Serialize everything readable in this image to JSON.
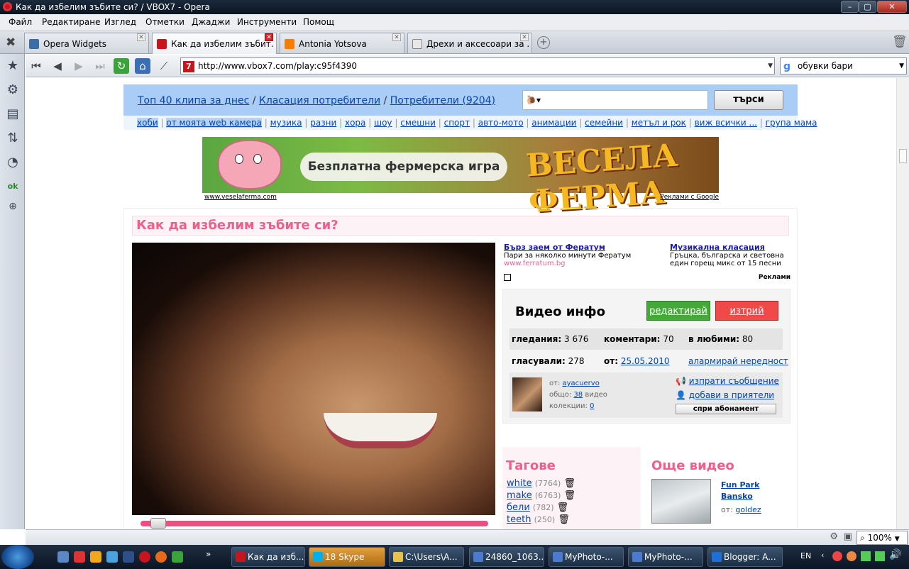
{
  "window": {
    "title": "Как да избелим зъбите си? / VBOX7 - Opera",
    "min": "–",
    "max": "▢",
    "close": "✕"
  },
  "menu": [
    "Файл",
    "Редактиране",
    "Изглед",
    "Отметки",
    "Джаджи",
    "Инструменти",
    "Помощ"
  ],
  "tabs": [
    {
      "label": "Opera Widgets",
      "icon_color": "#3a6ea5"
    },
    {
      "label": "Как да избелим зъбит...",
      "icon_color": "#c8141b"
    },
    {
      "label": "Antonia Yotsova",
      "icon_color": "#f57d00"
    },
    {
      "label": "Дрехи и аксесоари за ...",
      "icon_color": "#888888"
    }
  ],
  "nav": {
    "url": "http://www.vbox7.com/play:c95f4390",
    "url_icon": "7",
    "search_value": "обувки бари",
    "search_icon": "g"
  },
  "site": {
    "crumbs": [
      {
        "text": "Топ 40 клипа за днес"
      },
      {
        "sep": "/"
      },
      {
        "text": "Класация потребители"
      },
      {
        "sep": "/"
      },
      {
        "text": "Потребители (9204)"
      }
    ],
    "search_button": "търси",
    "categories": [
      "хоби",
      "от моята web камера",
      "музика",
      "разни",
      "хора",
      "шоу",
      "смешни",
      "спорт",
      "авто-мото",
      "анимации",
      "семейни",
      "метъл и рок",
      "виж всички ...",
      "група мама"
    ],
    "cat_sep": "|",
    "banner": {
      "pill": "Безплатна фермерска игра",
      "big": "ВЕСЕЛА ФЕРМА",
      "left_link": "www.veselaferma.com",
      "right_link": "Реклами с Google"
    },
    "video_title": "Как да избелим зъбите си?",
    "progress": 0.03,
    "ads": [
      {
        "title": "Бърз заем от Фератум",
        "line1": "Пари за няколко минути Фератум",
        "url": "www.ferratum.bg"
      },
      {
        "title": "Музикална класация",
        "line1": "Гръцка, българска и световна",
        "line2": "един горещ микс от 15 песни"
      }
    ],
    "ads_label": "Реклами",
    "info": {
      "heading": "Видео инфо",
      "edit": "редактирай",
      "delete": "изтрий",
      "views_label": "гледания:",
      "views": "3 676",
      "comments_label": "коментари:",
      "comments": "70",
      "fav_label": "в любими:",
      "fav": "80",
      "votes_label": "гласували:",
      "votes": "278",
      "from_label": "от:",
      "date": "25.05.2010",
      "report": "алармирай нередност",
      "user_from": "от:",
      "user": "ayacuervo",
      "total_label": "общо:",
      "total": "38",
      "total_suffix": "видео",
      "coll_label": "колекции:",
      "coll": "0",
      "send_msg": "изпрати съобщение",
      "add_friend": "добави в приятели",
      "unsubscribe": "спри абонамент"
    },
    "tags_heading": "Тагове",
    "tags": [
      {
        "name": "white",
        "count": "(7764)"
      },
      {
        "name": "make",
        "count": "(6763)"
      },
      {
        "name": "бели",
        "count": "(782)"
      },
      {
        "name": "teeth",
        "count": "(250)"
      }
    ],
    "more_heading": "Още видео",
    "more_video": {
      "title1": "Fun Park",
      "title2": "Bansko",
      "from": "от:",
      "user": "goldez"
    }
  },
  "statusbar": {
    "zoom": "100%"
  },
  "taskbar": {
    "buttons": [
      {
        "label": "Как да изб...",
        "color": "#c8141b"
      },
      {
        "label": "18 Skype",
        "color": "#00aff0"
      },
      {
        "label": "C:\\Users\\A...",
        "color": "#e8c04a"
      },
      {
        "label": "24860_1063...",
        "color": "#4a7bd0"
      },
      {
        "label": "MyPhoto-...",
        "color": "#4a7bd0"
      },
      {
        "label": "MyPhoto-...",
        "color": "#4a7bd0"
      },
      {
        "label": "Blogger: A...",
        "color": "#1e6fd9"
      }
    ],
    "lang": "EN"
  }
}
